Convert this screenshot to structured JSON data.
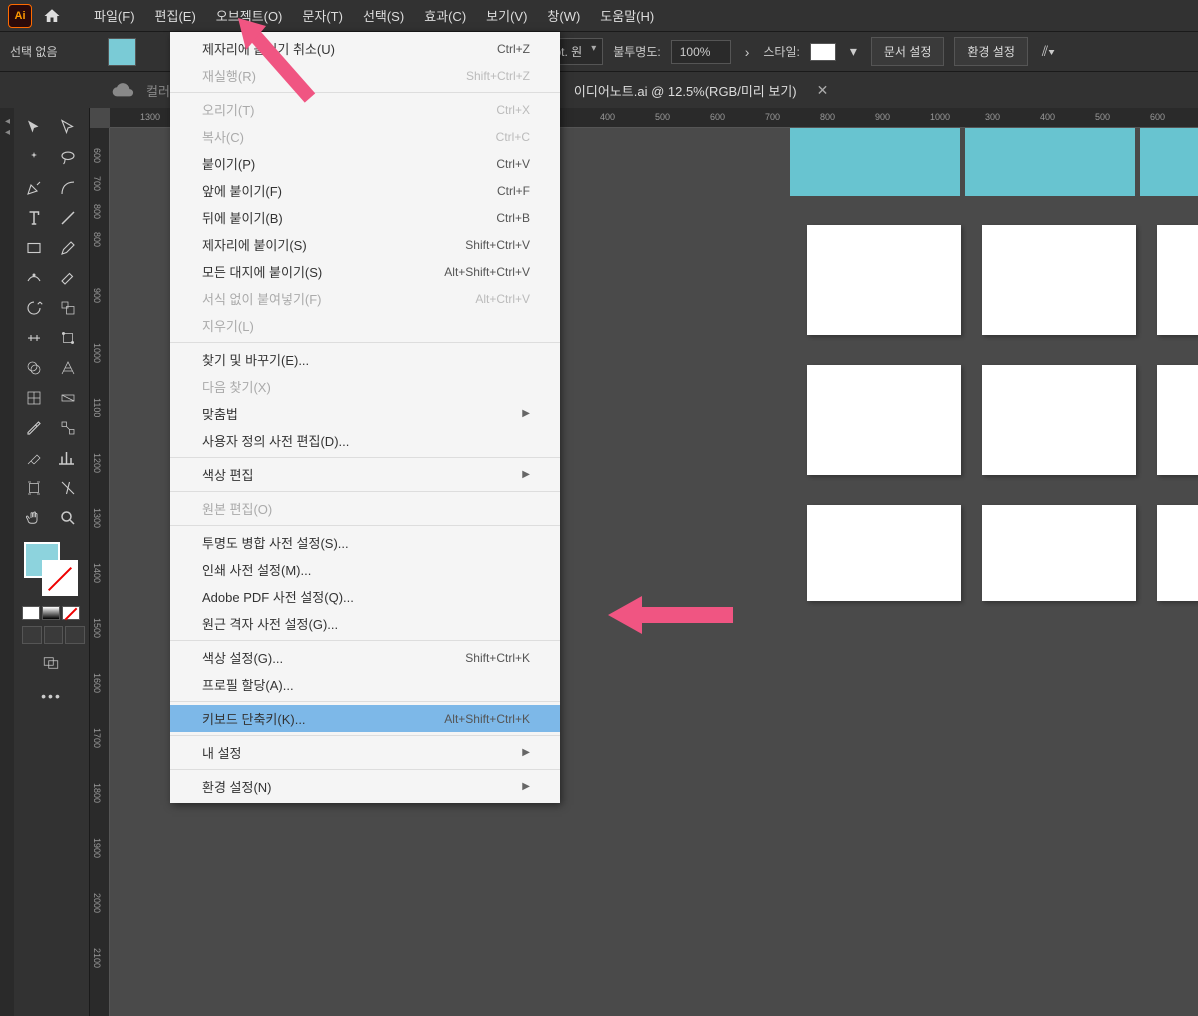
{
  "menubar": {
    "items": [
      "파일(F)",
      "편집(E)",
      "오브젝트(O)",
      "문자(T)",
      "선택(S)",
      "효과(C)",
      "보기(V)",
      "창(W)",
      "도움말(H)"
    ]
  },
  "toolbar": {
    "selection_label": "선택 없음",
    "stroke_label": "pt. 원",
    "opacity_label": "불투명도:",
    "opacity_value": "100%",
    "style_label": "스타일:",
    "doc_settings": "문서 설정",
    "env_settings": "환경 설정"
  },
  "tabs": {
    "color_label": "컬러",
    "doc_name": "이디어노트.ai @ 12.5%(RGB/미리 보기)",
    "close": "✕"
  },
  "ruler_h_ticks": [
    {
      "pos": 30,
      "label": "1300"
    },
    {
      "pos": 490,
      "label": "400"
    },
    {
      "pos": 545,
      "label": "500"
    },
    {
      "pos": 600,
      "label": "600"
    },
    {
      "pos": 655,
      "label": "700"
    },
    {
      "pos": 710,
      "label": "800"
    },
    {
      "pos": 765,
      "label": "900"
    },
    {
      "pos": 820,
      "label": "1000"
    },
    {
      "pos": 875,
      "label": "300"
    },
    {
      "pos": 930,
      "label": "400"
    },
    {
      "pos": 985,
      "label": "500"
    },
    {
      "pos": 1040,
      "label": "600"
    }
  ],
  "ruler_v_ticks": [
    {
      "pos": 20,
      "label": "600"
    },
    {
      "pos": 48,
      "label": "700"
    },
    {
      "pos": 76,
      "label": "800"
    },
    {
      "pos": 104,
      "label": "800"
    },
    {
      "pos": 160,
      "label": "900"
    },
    {
      "pos": 215,
      "label": "1000"
    },
    {
      "pos": 270,
      "label": "1100"
    },
    {
      "pos": 325,
      "label": "1200"
    },
    {
      "pos": 380,
      "label": "1300"
    },
    {
      "pos": 435,
      "label": "1400"
    },
    {
      "pos": 490,
      "label": "1500"
    },
    {
      "pos": 545,
      "label": "1600"
    },
    {
      "pos": 600,
      "label": "1700"
    },
    {
      "pos": 655,
      "label": "1800"
    },
    {
      "pos": 710,
      "label": "1900"
    },
    {
      "pos": 765,
      "label": "2000"
    },
    {
      "pos": 820,
      "label": "2100"
    }
  ],
  "edit_menu": {
    "groups": [
      [
        {
          "label": "제자리에 붙이기 취소(U)",
          "shortcut": "Ctrl+Z",
          "disabled": false
        },
        {
          "label": "재실행(R)",
          "shortcut": "Shift+Ctrl+Z",
          "disabled": true
        }
      ],
      [
        {
          "label": "오리기(T)",
          "shortcut": "Ctrl+X",
          "disabled": true
        },
        {
          "label": "복사(C)",
          "shortcut": "Ctrl+C",
          "disabled": true
        },
        {
          "label": "붙이기(P)",
          "shortcut": "Ctrl+V",
          "disabled": false
        },
        {
          "label": "앞에 붙이기(F)",
          "shortcut": "Ctrl+F",
          "disabled": false
        },
        {
          "label": "뒤에 붙이기(B)",
          "shortcut": "Ctrl+B",
          "disabled": false
        },
        {
          "label": "제자리에 붙이기(S)",
          "shortcut": "Shift+Ctrl+V",
          "disabled": false
        },
        {
          "label": "모든 대지에 붙이기(S)",
          "shortcut": "Alt+Shift+Ctrl+V",
          "disabled": false
        },
        {
          "label": "서식 없이 붙여넣기(F)",
          "shortcut": "Alt+Ctrl+V",
          "disabled": true
        },
        {
          "label": "지우기(L)",
          "shortcut": "",
          "disabled": true
        }
      ],
      [
        {
          "label": "찾기 및 바꾸기(E)...",
          "shortcut": "",
          "disabled": false
        },
        {
          "label": "다음 찾기(X)",
          "shortcut": "",
          "disabled": true
        },
        {
          "label": "맞춤법",
          "shortcut": "",
          "disabled": false,
          "submenu": true
        },
        {
          "label": "사용자 정의 사전 편집(D)...",
          "shortcut": "",
          "disabled": false
        }
      ],
      [
        {
          "label": "색상 편집",
          "shortcut": "",
          "disabled": false,
          "submenu": true
        }
      ],
      [
        {
          "label": "원본 편집(O)",
          "shortcut": "",
          "disabled": true
        }
      ],
      [
        {
          "label": "투명도 병합 사전 설정(S)...",
          "shortcut": "",
          "disabled": false
        },
        {
          "label": "인쇄 사전 설정(M)...",
          "shortcut": "",
          "disabled": false
        },
        {
          "label": "Adobe PDF 사전 설정(Q)...",
          "shortcut": "",
          "disabled": false
        },
        {
          "label": "원근 격자 사전 설정(G)...",
          "shortcut": "",
          "disabled": false
        }
      ],
      [
        {
          "label": "색상 설정(G)...",
          "shortcut": "Shift+Ctrl+K",
          "disabled": false
        },
        {
          "label": "프로필 할당(A)...",
          "shortcut": "",
          "disabled": false
        }
      ],
      [
        {
          "label": "키보드 단축키(K)...",
          "shortcut": "Alt+Shift+Ctrl+K",
          "disabled": false,
          "highlighted": true
        }
      ],
      [
        {
          "label": "내 설정",
          "shortcut": "",
          "disabled": false,
          "submenu": true
        }
      ],
      [
        {
          "label": "환경 설정(N)",
          "shortcut": "",
          "disabled": false,
          "submenu": true
        }
      ]
    ]
  }
}
